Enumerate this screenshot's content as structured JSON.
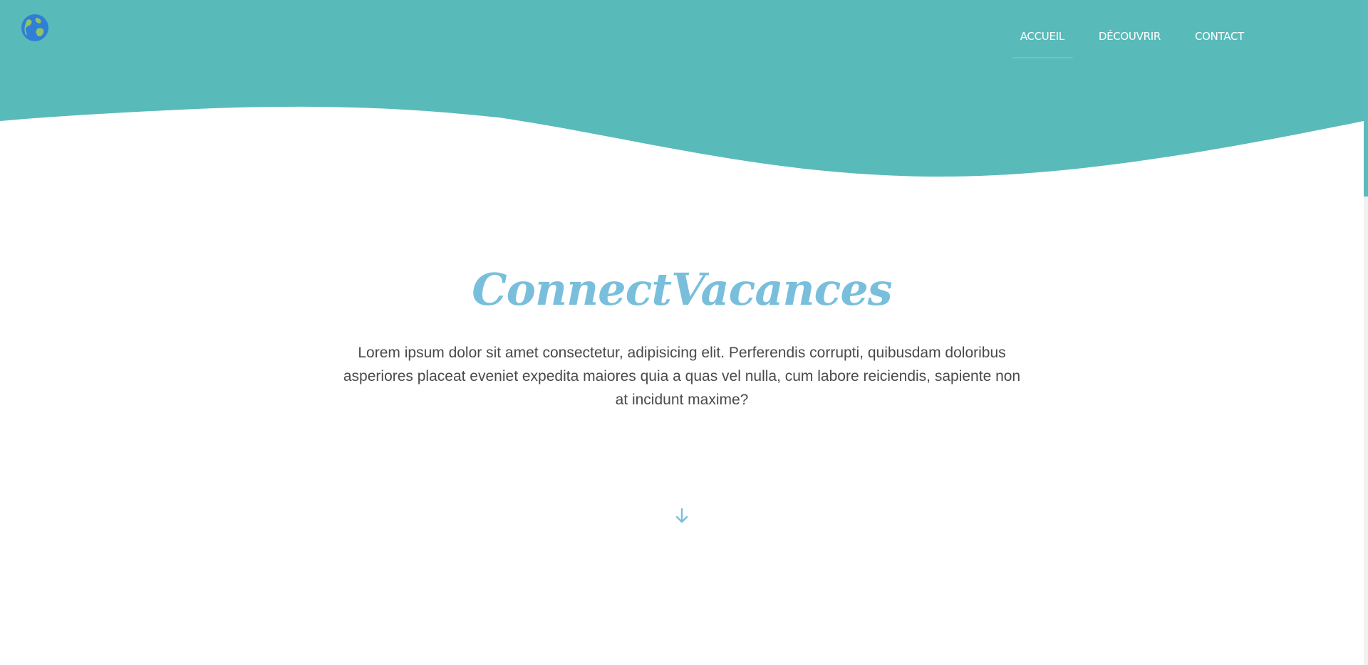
{
  "header": {
    "logo_icon": "globe-icon",
    "background_color": "#59baba",
    "nav": [
      {
        "label": "ACCUEIL",
        "active": true
      },
      {
        "label": "DÉCOUVRIR",
        "active": false
      },
      {
        "label": "CONTACT",
        "active": false
      }
    ]
  },
  "hero": {
    "title": "ConnectVacances",
    "text": "Lorem ipsum dolor sit amet consectetur, adipisicing elit. Perferendis corrupti, quibusdam doloribus asperiores placeat eveniet expedita maiores quia a quas vel nulla, cum labore reiciendis, sapiente non at incidunt maxime?",
    "title_color": "#79bfdc",
    "scroll_icon": "arrow-down-icon"
  }
}
